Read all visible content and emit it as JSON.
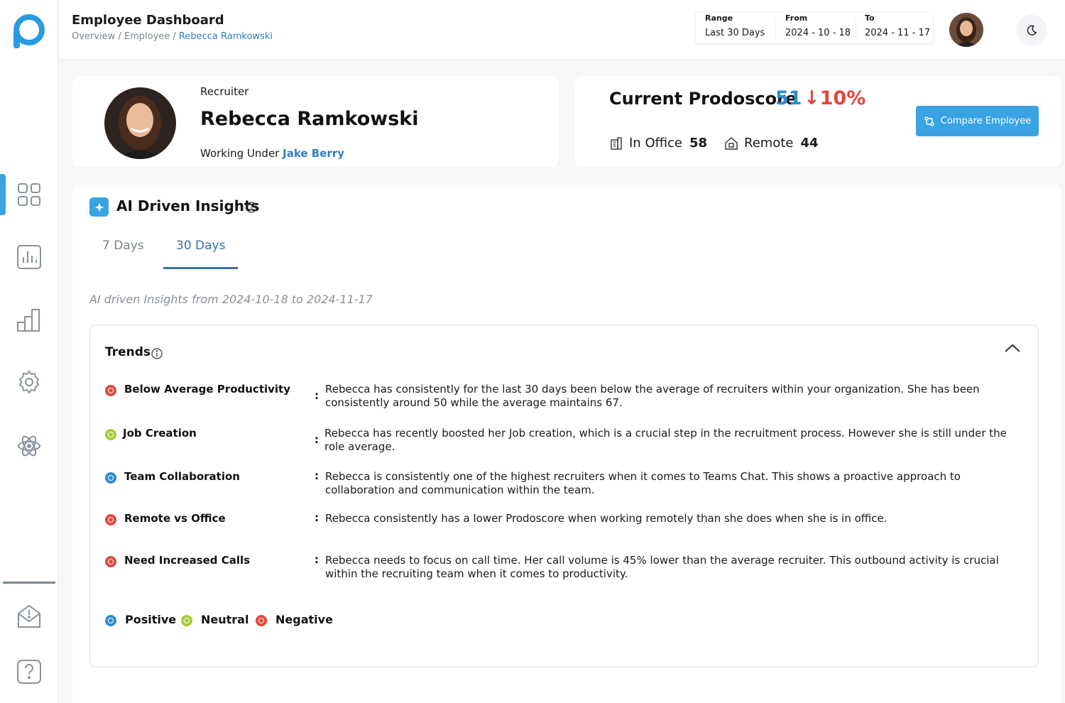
{
  "header": {
    "title": "Employee Dashboard",
    "breadcrumb": {
      "part1": "Overview",
      "part2": "Employee",
      "current": "Rebecca Ramkowski"
    },
    "range": {
      "label": "Range",
      "value": "Last 30 Days"
    },
    "from": {
      "label": "From",
      "value": "2024 - 10 - 18"
    },
    "to": {
      "label": "To",
      "value": "2024 - 11 - 17"
    }
  },
  "sidebar": {
    "items": [
      {
        "name": "dashboard",
        "icon": "grid-icon",
        "active": true
      },
      {
        "name": "reports",
        "icon": "bar-chart-icon"
      },
      {
        "name": "analytics",
        "icon": "stepped-bars-icon"
      },
      {
        "name": "settings",
        "icon": "gear-icon"
      },
      {
        "name": "integrations",
        "icon": "atom-icon"
      },
      {
        "name": "notifications",
        "icon": "envelope-alert-icon"
      },
      {
        "name": "help",
        "icon": "question-icon"
      }
    ]
  },
  "profile": {
    "role": "Recruiter",
    "name": "Rebecca Ramkowski",
    "working_under_label": "Working Under",
    "manager": "Jake Berry"
  },
  "score": {
    "title": "Current Prodoscore",
    "value": "51",
    "change": "↓10%",
    "in_office_label": "In Office",
    "in_office_value": "58",
    "remote_label": "Remote",
    "remote_value": "44",
    "compare_button": "Compare Employee"
  },
  "insights": {
    "title": "AI Driven Insights",
    "tabs": [
      {
        "label": "7 Days",
        "active": false
      },
      {
        "label": "30 Days",
        "active": true
      }
    ],
    "range_text": "AI driven Insights from 2024-10-18 to 2024-11-17",
    "trends_title": "Trends",
    "trends": [
      {
        "name": "Below Average Productivity",
        "sentiment": "negative",
        "description": "Rebecca has consistently for the last 30 days been below the average of recruiters within your organization.  She has been consistently around 50 while the average maintains 67."
      },
      {
        "name": "Job Creation",
        "sentiment": "neutral",
        "description": "Rebecca has recently boosted her Job creation, which is a crucial step in the recruitment process.  However she is still under the role average."
      },
      {
        "name": "Team Collaboration",
        "sentiment": "positive",
        "description": "Rebecca is consistently one of the highest recruiters when it comes to Teams Chat. This shows a proactive approach to collaboration and communication within the team."
      },
      {
        "name": "Remote vs Office",
        "sentiment": "negative",
        "description": "Rebecca consistently has a lower Prodoscore when working remotely than she does when she is in office."
      },
      {
        "name": "Need Increased Calls",
        "sentiment": "negative",
        "description": "Rebecca needs to focus on call time.  Her call volume is 45% lower than the average recruiter.  This outbound activity is crucial within the recruiting team when it comes to productivity."
      }
    ],
    "legend": {
      "positive": "Positive",
      "neutral": "Neutral",
      "negative": "Negative"
    }
  },
  "colors": {
    "accent": "#3aa3e3",
    "link": "#2e7fc4",
    "negative": "#e3473f",
    "neutral": "#a6cc3a",
    "positive": "#2e8bd0"
  }
}
